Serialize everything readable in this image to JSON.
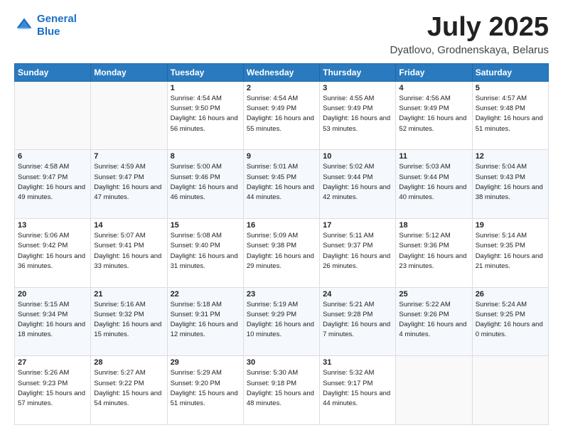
{
  "header": {
    "logo_line1": "General",
    "logo_line2": "Blue",
    "month": "July 2025",
    "location": "Dyatlovo, Grodnenskaya, Belarus"
  },
  "weekdays": [
    "Sunday",
    "Monday",
    "Tuesday",
    "Wednesday",
    "Thursday",
    "Friday",
    "Saturday"
  ],
  "weeks": [
    [
      {
        "day": "",
        "info": ""
      },
      {
        "day": "",
        "info": ""
      },
      {
        "day": "1",
        "info": "Sunrise: 4:54 AM\nSunset: 9:50 PM\nDaylight: 16 hours and 56 minutes."
      },
      {
        "day": "2",
        "info": "Sunrise: 4:54 AM\nSunset: 9:49 PM\nDaylight: 16 hours and 55 minutes."
      },
      {
        "day": "3",
        "info": "Sunrise: 4:55 AM\nSunset: 9:49 PM\nDaylight: 16 hours and 53 minutes."
      },
      {
        "day": "4",
        "info": "Sunrise: 4:56 AM\nSunset: 9:49 PM\nDaylight: 16 hours and 52 minutes."
      },
      {
        "day": "5",
        "info": "Sunrise: 4:57 AM\nSunset: 9:48 PM\nDaylight: 16 hours and 51 minutes."
      }
    ],
    [
      {
        "day": "6",
        "info": "Sunrise: 4:58 AM\nSunset: 9:47 PM\nDaylight: 16 hours and 49 minutes."
      },
      {
        "day": "7",
        "info": "Sunrise: 4:59 AM\nSunset: 9:47 PM\nDaylight: 16 hours and 47 minutes."
      },
      {
        "day": "8",
        "info": "Sunrise: 5:00 AM\nSunset: 9:46 PM\nDaylight: 16 hours and 46 minutes."
      },
      {
        "day": "9",
        "info": "Sunrise: 5:01 AM\nSunset: 9:45 PM\nDaylight: 16 hours and 44 minutes."
      },
      {
        "day": "10",
        "info": "Sunrise: 5:02 AM\nSunset: 9:44 PM\nDaylight: 16 hours and 42 minutes."
      },
      {
        "day": "11",
        "info": "Sunrise: 5:03 AM\nSunset: 9:44 PM\nDaylight: 16 hours and 40 minutes."
      },
      {
        "day": "12",
        "info": "Sunrise: 5:04 AM\nSunset: 9:43 PM\nDaylight: 16 hours and 38 minutes."
      }
    ],
    [
      {
        "day": "13",
        "info": "Sunrise: 5:06 AM\nSunset: 9:42 PM\nDaylight: 16 hours and 36 minutes."
      },
      {
        "day": "14",
        "info": "Sunrise: 5:07 AM\nSunset: 9:41 PM\nDaylight: 16 hours and 33 minutes."
      },
      {
        "day": "15",
        "info": "Sunrise: 5:08 AM\nSunset: 9:40 PM\nDaylight: 16 hours and 31 minutes."
      },
      {
        "day": "16",
        "info": "Sunrise: 5:09 AM\nSunset: 9:38 PM\nDaylight: 16 hours and 29 minutes."
      },
      {
        "day": "17",
        "info": "Sunrise: 5:11 AM\nSunset: 9:37 PM\nDaylight: 16 hours and 26 minutes."
      },
      {
        "day": "18",
        "info": "Sunrise: 5:12 AM\nSunset: 9:36 PM\nDaylight: 16 hours and 23 minutes."
      },
      {
        "day": "19",
        "info": "Sunrise: 5:14 AM\nSunset: 9:35 PM\nDaylight: 16 hours and 21 minutes."
      }
    ],
    [
      {
        "day": "20",
        "info": "Sunrise: 5:15 AM\nSunset: 9:34 PM\nDaylight: 16 hours and 18 minutes."
      },
      {
        "day": "21",
        "info": "Sunrise: 5:16 AM\nSunset: 9:32 PM\nDaylight: 16 hours and 15 minutes."
      },
      {
        "day": "22",
        "info": "Sunrise: 5:18 AM\nSunset: 9:31 PM\nDaylight: 16 hours and 12 minutes."
      },
      {
        "day": "23",
        "info": "Sunrise: 5:19 AM\nSunset: 9:29 PM\nDaylight: 16 hours and 10 minutes."
      },
      {
        "day": "24",
        "info": "Sunrise: 5:21 AM\nSunset: 9:28 PM\nDaylight: 16 hours and 7 minutes."
      },
      {
        "day": "25",
        "info": "Sunrise: 5:22 AM\nSunset: 9:26 PM\nDaylight: 16 hours and 4 minutes."
      },
      {
        "day": "26",
        "info": "Sunrise: 5:24 AM\nSunset: 9:25 PM\nDaylight: 16 hours and 0 minutes."
      }
    ],
    [
      {
        "day": "27",
        "info": "Sunrise: 5:26 AM\nSunset: 9:23 PM\nDaylight: 15 hours and 57 minutes."
      },
      {
        "day": "28",
        "info": "Sunrise: 5:27 AM\nSunset: 9:22 PM\nDaylight: 15 hours and 54 minutes."
      },
      {
        "day": "29",
        "info": "Sunrise: 5:29 AM\nSunset: 9:20 PM\nDaylight: 15 hours and 51 minutes."
      },
      {
        "day": "30",
        "info": "Sunrise: 5:30 AM\nSunset: 9:18 PM\nDaylight: 15 hours and 48 minutes."
      },
      {
        "day": "31",
        "info": "Sunrise: 5:32 AM\nSunset: 9:17 PM\nDaylight: 15 hours and 44 minutes."
      },
      {
        "day": "",
        "info": ""
      },
      {
        "day": "",
        "info": ""
      }
    ]
  ]
}
